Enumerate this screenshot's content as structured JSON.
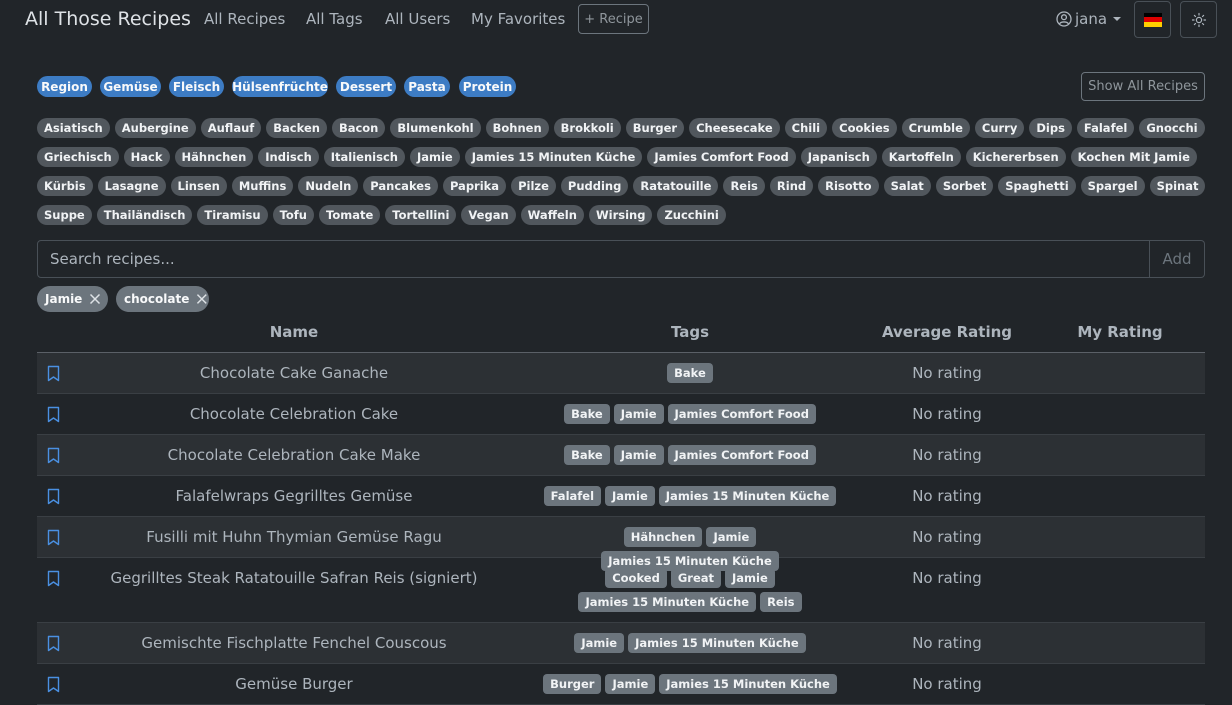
{
  "nav": {
    "brand": "All Those Recipes",
    "links": [
      "All Recipes",
      "All Tags",
      "All Users",
      "My Favorites"
    ],
    "new_recipe": "+ Recipe",
    "username": "jana",
    "language_icon": "german-flag-icon",
    "theme_icon": "sun-icon"
  },
  "colors": {
    "category_badge": "#3d7cc4",
    "tag_badge": "#51575d",
    "bookmark": "#4a90e2"
  },
  "categories": [
    "Region",
    "Gemüse",
    "Fleisch",
    "Hülsenfrüchte",
    "Dessert",
    "Pasta",
    "Protein"
  ],
  "show_all": "Show All Recipes",
  "tags": [
    "Asiatisch",
    "Aubergine",
    "Auflauf",
    "Backen",
    "Bacon",
    "Blumenkohl",
    "Bohnen",
    "Brokkoli",
    "Burger",
    "Cheesecake",
    "Chili",
    "Cookies",
    "Crumble",
    "Curry",
    "Dips",
    "Falafel",
    "Gnocchi",
    "Griechisch",
    "Hack",
    "Hähnchen",
    "Indisch",
    "Italienisch",
    "Jamie",
    "Jamies 15 Minuten Küche",
    "Jamies Comfort Food",
    "Japanisch",
    "Kartoffeln",
    "Kichererbsen",
    "Kochen Mit Jamie",
    "Kürbis",
    "Lasagne",
    "Linsen",
    "Muffins",
    "Nudeln",
    "Pancakes",
    "Paprika",
    "Pilze",
    "Pudding",
    "Ratatouille",
    "Reis",
    "Rind",
    "Risotto",
    "Salat",
    "Sorbet",
    "Spaghetti",
    "Spargel",
    "Spinat",
    "Suppe",
    "Thailändisch",
    "Tiramisu",
    "Tofu",
    "Tomate",
    "Tortellini",
    "Vegan",
    "Waffeln",
    "Wirsing",
    "Zucchini"
  ],
  "search": {
    "placeholder": "Search recipes...",
    "add_label": "Add"
  },
  "filters": [
    "Jamie",
    "chocolate"
  ],
  "table": {
    "headers": {
      "name": "Name",
      "tags": "Tags",
      "avg": "Average Rating",
      "mine": "My Rating"
    },
    "rows": [
      {
        "name": "Chocolate Cake Ganache",
        "tags": [
          "Bake"
        ],
        "avg": "No rating",
        "mine": ""
      },
      {
        "name": "Chocolate Celebration Cake",
        "tags": [
          "Bake",
          "Jamie",
          "Jamies Comfort Food"
        ],
        "avg": "No rating",
        "mine": ""
      },
      {
        "name": "Chocolate Celebration Cake Make",
        "tags": [
          "Bake",
          "Jamie",
          "Jamies Comfort Food"
        ],
        "avg": "No rating",
        "mine": ""
      },
      {
        "name": "Falafelwraps Gegrilltes Gemüse",
        "tags": [
          "Falafel",
          "Jamie",
          "Jamies 15 Minuten Küche"
        ],
        "avg": "No rating",
        "mine": ""
      },
      {
        "name": "Fusilli mit Huhn Thymian Gemüse Ragu",
        "tags": [
          "Hähnchen",
          "Jamie",
          "Jamies 15 Minuten Küche"
        ],
        "avg": "No rating",
        "mine": ""
      },
      {
        "name": "Gegrilltes Steak Ratatouille Safran Reis (signiert)",
        "tags": [
          "Cooked",
          "Great",
          "Jamie",
          "Jamies 15 Minuten Küche",
          "Reis"
        ],
        "avg": "No rating",
        "mine": ""
      },
      {
        "name": "Gemischte Fischplatte Fenchel Couscous",
        "tags": [
          "Jamie",
          "Jamies 15 Minuten Küche"
        ],
        "avg": "No rating",
        "mine": ""
      },
      {
        "name": "Gemüse Burger",
        "tags": [
          "Burger",
          "Jamie",
          "Jamies 15 Minuten Küche"
        ],
        "avg": "No rating",
        "mine": ""
      }
    ]
  }
}
